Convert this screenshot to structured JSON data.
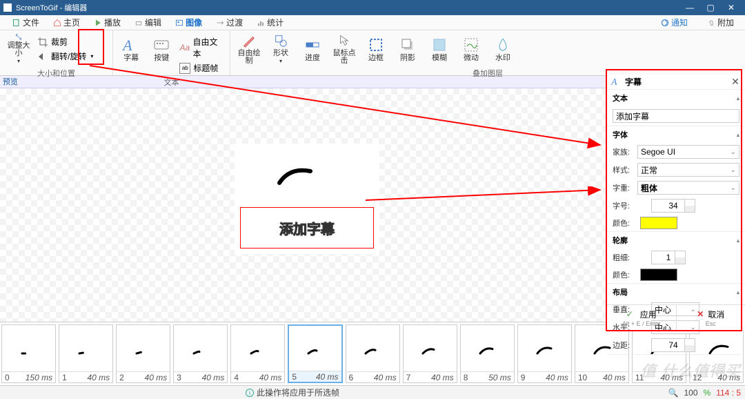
{
  "title": "ScreenToGif - 编辑器",
  "menubar": {
    "file": "文件",
    "home": "主页",
    "play": "播放",
    "edit": "编辑",
    "image": "图像",
    "transition": "过渡",
    "stats": "统计",
    "notify": "通知",
    "attach": "附加"
  },
  "ribbon": {
    "resize": "调整大小",
    "crop": "裁剪",
    "fliprotate": "翻转/旋转",
    "grp_sizepos": "大小和位置",
    "caption": "字幕",
    "keys": "按键",
    "freetext": "自由文本",
    "titleframe": "标题帧",
    "grp_text": "文本",
    "freedraw": "自由绘制",
    "shapes": "形状",
    "progress": "进度",
    "mouseclick": "鼠标点击",
    "border": "边框",
    "shadow": "阴影",
    "blur": "模糊",
    "micro": "微动",
    "watermark": "水印",
    "grp_overlay": "叠加图层"
  },
  "preview": {
    "label": "预览",
    "subtitle_text": "添加字幕"
  },
  "panel": {
    "title": "字幕",
    "section_text": "文本",
    "text_value": "添加字幕",
    "section_font": "字体",
    "family_lbl": "家族:",
    "family_val": "Segoe UI",
    "style_lbl": "样式:",
    "style_val": "正常",
    "weight_lbl": "字重:",
    "weight_val": "粗体",
    "size_lbl": "字号:",
    "size_val": "34",
    "color_lbl": "颜色:",
    "section_outline": "轮廓",
    "thick_lbl": "粗细:",
    "thick_val": "1",
    "ocolor_lbl": "颜色:",
    "section_layout": "布局",
    "vert_lbl": "垂直:",
    "vert_val": "中心",
    "horz_lbl": "水平:",
    "horz_val": "中心",
    "margin_lbl": "边距:",
    "margin_val": "74",
    "apply": "应用",
    "apply_sub": "Alt + E / Enter",
    "cancel": "取消",
    "cancel_sub": "Esc"
  },
  "frames": [
    {
      "n": "0",
      "t": "150 ms"
    },
    {
      "n": "1",
      "t": "40 ms"
    },
    {
      "n": "2",
      "t": "40 ms"
    },
    {
      "n": "3",
      "t": "40 ms"
    },
    {
      "n": "4",
      "t": "40 ms"
    },
    {
      "n": "5",
      "t": "40 ms"
    },
    {
      "n": "6",
      "t": "40 ms"
    },
    {
      "n": "7",
      "t": "40 ms"
    },
    {
      "n": "8",
      "t": "50 ms"
    },
    {
      "n": "9",
      "t": "40 ms"
    },
    {
      "n": "10",
      "t": "40 ms"
    },
    {
      "n": "11",
      "t": "40 ms"
    },
    {
      "n": "12",
      "t": "40 ms"
    }
  ],
  "status": {
    "msg": "此操作将应用于所选帧",
    "zoom": "100",
    "size": "114 : 5"
  },
  "watermark": "值 什么值得买"
}
